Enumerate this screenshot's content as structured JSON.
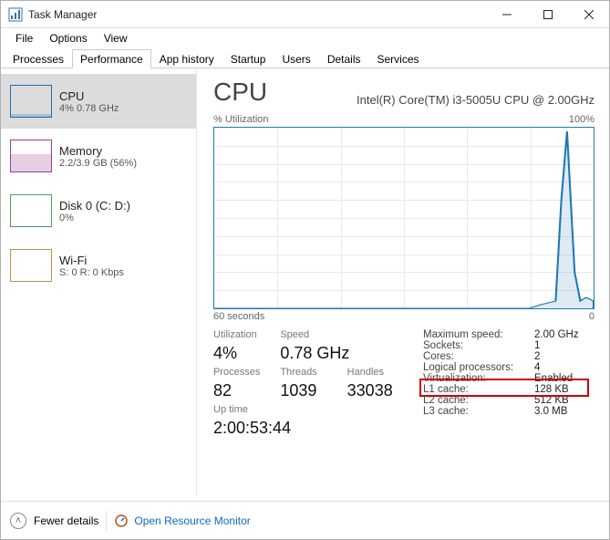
{
  "window": {
    "title": "Task Manager"
  },
  "menu": {
    "file": "File",
    "options": "Options",
    "view": "View"
  },
  "tabs": {
    "processes": "Processes",
    "performance": "Performance",
    "apphistory": "App history",
    "startup": "Startup",
    "users": "Users",
    "details": "Details",
    "services": "Services"
  },
  "sidebar": {
    "cpu": {
      "label": "CPU",
      "sub": "4% 0.78 GHz"
    },
    "mem": {
      "label": "Memory",
      "sub": "2.2/3.9 GB (56%)"
    },
    "disk": {
      "label": "Disk 0 (C: D:)",
      "sub": "0%"
    },
    "wifi": {
      "label": "Wi-Fi",
      "sub": "S: 0 R: 0 Kbps"
    }
  },
  "main": {
    "title": "CPU",
    "model": "Intel(R) Core(TM) i3-5005U CPU @ 2.00GHz",
    "util_label": "% Utilization",
    "max_label": "100%",
    "axis_left": "60 seconds",
    "axis_right": "0",
    "labels": {
      "utilization": "Utilization",
      "speed": "Speed",
      "processes": "Processes",
      "threads": "Threads",
      "handles": "Handles",
      "uptime": "Up time",
      "maxspeed": "Maximum speed:",
      "sockets": "Sockets:",
      "cores": "Cores:",
      "logical": "Logical processors:",
      "virtualization": "Virtualization:",
      "l1": "L1 cache:",
      "l2": "L2 cache:",
      "l3": "L3 cache:"
    },
    "values": {
      "utilization": "4%",
      "speed": "0.78 GHz",
      "processes": "82",
      "threads": "1039",
      "handles": "33038",
      "uptime": "2:00:53:44",
      "maxspeed": "2.00 GHz",
      "sockets": "1",
      "cores": "2",
      "logical": "4",
      "virtualization": "Enabled",
      "l1": "128 KB",
      "l2": "512 KB",
      "l3": "3.0 MB"
    }
  },
  "status": {
    "fewer": "Fewer details",
    "resmon": "Open Resource Monitor"
  },
  "chart_data": {
    "type": "line",
    "title": "% Utilization",
    "xlabel": "60 seconds",
    "ylabel": "",
    "ylim": [
      0,
      100
    ],
    "x_seconds_ago": [
      60,
      55,
      50,
      45,
      40,
      35,
      30,
      25,
      20,
      15,
      10,
      8,
      6,
      5,
      4,
      3,
      2,
      1,
      0
    ],
    "values": [
      0,
      0,
      0,
      0,
      0,
      0,
      0,
      0,
      0,
      0,
      0,
      2,
      4,
      60,
      98,
      20,
      4,
      6,
      4
    ]
  }
}
